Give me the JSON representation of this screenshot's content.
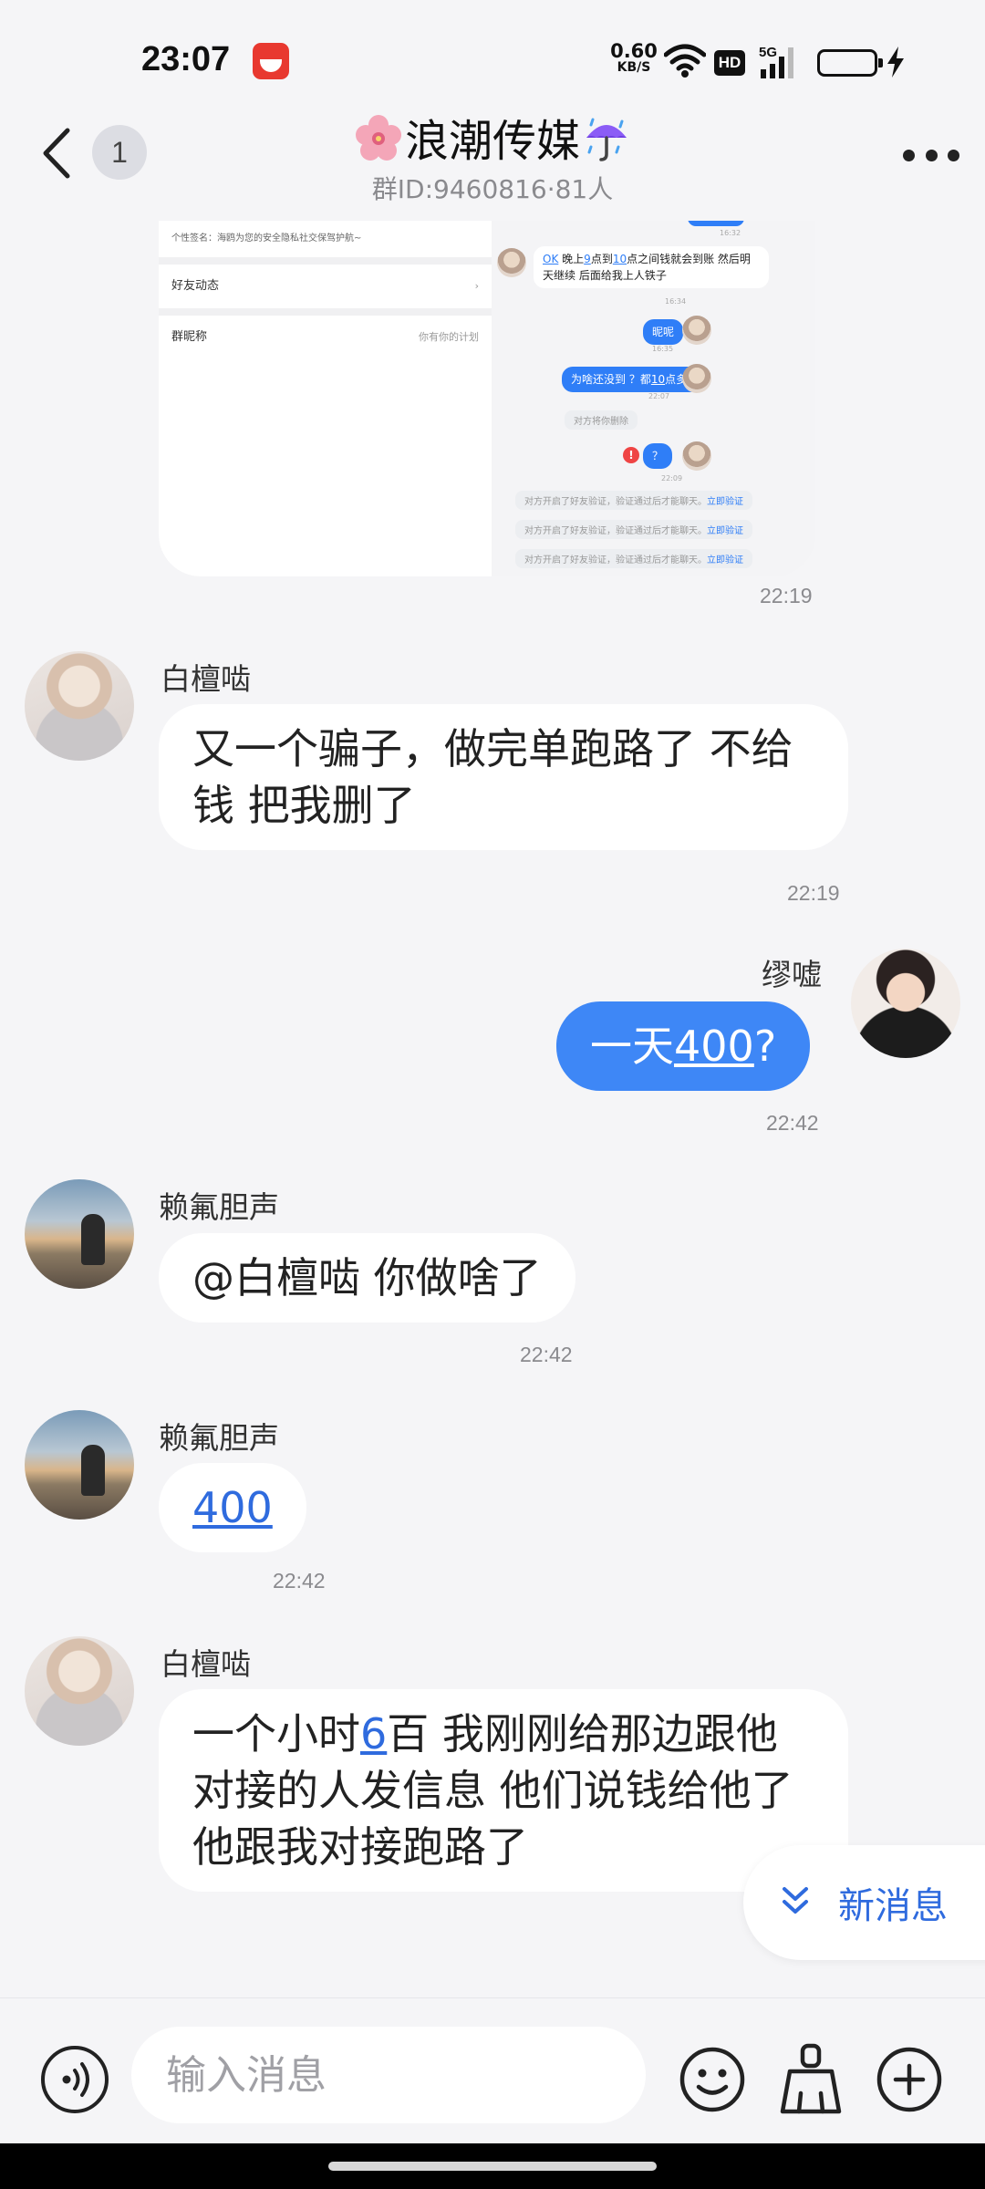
{
  "status_bar": {
    "time": "23:07",
    "net_speed": "0.60",
    "net_unit": "KB/S",
    "hd_label": "HD",
    "network": "5G"
  },
  "header": {
    "unread_count": "1",
    "title": "浪潮传媒",
    "subtitle": "群ID:9460816·81人"
  },
  "screenshot": {
    "left_rows": [
      {
        "label": "个性签名：海鸥为您的安全隐私社交保驾护航~",
        "value": ""
      },
      {
        "label": "好友动态",
        "value": "›"
      },
      {
        "label": "群昵称",
        "value": "你有你的计划"
      }
    ],
    "right_msgs": {
      "ok_text": "OK",
      "in_msg_1": "晚上",
      "in_msg_1_n1": "9",
      "in_msg_1_b": "点到",
      "in_msg_1_n2": "10",
      "in_msg_1_c": "点之间钱就会到账 然后明天继续 后面给我上人铁子",
      "t1": "16:32",
      "t2": "16:34",
      "out_msg_1": "昵呢",
      "t3": "16:35",
      "out_msg_2a": "为啥还没到 ？都",
      "out_msg_2n": "10",
      "out_msg_2b": "点多了",
      "t4": "22:07",
      "sys_deleted": "对方将你删除",
      "out_msg_3": "？",
      "t5": "22:09",
      "sys_verify": "对方开启了好友验证，验证通过后才能聊天。",
      "sys_verify_link": "立即验证"
    },
    "time": "22:19"
  },
  "messages": [
    {
      "sender": "白檀啮",
      "text": "又一个骗子，做完单跑路了  不给钱 把我删了",
      "time": "22:19"
    },
    {
      "sender": "缪嘘",
      "text_a": "一天",
      "text_link": "400",
      "text_b": "?",
      "time": "22:42"
    },
    {
      "sender": "赖氟胆声",
      "text": "@白檀啮 你做啥了",
      "time": "22:42"
    },
    {
      "sender": "赖氟胆声",
      "text_link": "400",
      "time": "22:42"
    },
    {
      "sender": "白檀啮",
      "text_a": "一个小时",
      "text_link": "6",
      "text_b": "百  我刚刚给那边跟他对接的人发信息  他们说钱给他了  他跟我对接跑路了"
    }
  ],
  "new_message_pill": "新消息",
  "input": {
    "placeholder": "输入消息"
  },
  "icons": {
    "back": "chevron-left-icon",
    "more": "more-dots-icon",
    "voice": "voice-icon",
    "emoji": "emoji-icon",
    "clean": "broom-icon",
    "plus": "plus-icon"
  },
  "colors": {
    "accent": "#3e87f6",
    "link": "#2f6bde",
    "background": "#f5f5f7"
  }
}
